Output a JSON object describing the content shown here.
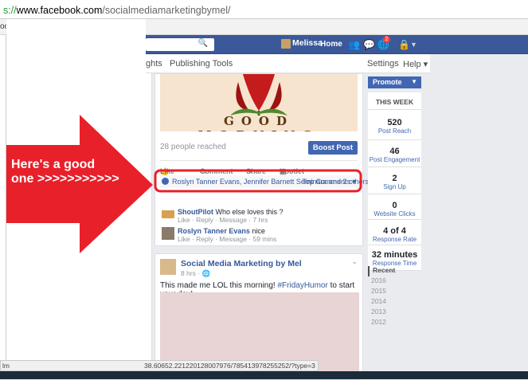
{
  "browser": {
    "url_scheme": "s://",
    "url_host": "www.facebook.com",
    "url_path": "/socialmediamarketingbymel/",
    "bookmark_stub": "oo",
    "status_url": "38.60652.221220128007976/785413978255252/?type=3",
    "status_stub": "lm"
  },
  "fb_header": {
    "user_name": "Melissa",
    "home_label": "Home",
    "notification_count": "2"
  },
  "subnav": {
    "insights_fragment": "ghts",
    "publishing_tools": "Publishing Tools",
    "settings": "Settings",
    "help": "Help ▾"
  },
  "post1": {
    "image_text": "GOOD MORNING",
    "reach": "28 people reached",
    "boost_label": "Boost Post",
    "actions": {
      "like": "Like",
      "comment": "Comment",
      "share": "Share",
      "hootlet": "Hootlet"
    },
    "likers": "Roslyn Tanner Evans, Jennifer Barnett Seminara and 2 others",
    "top_comments": "Top Comments ▾",
    "comments": [
      {
        "name": "ShoutPilot",
        "text": "Who else loves this ?",
        "meta": "Like · Reply · Message · 7 hrs"
      },
      {
        "name": "Roslyn Tanner Evans",
        "text": "nice",
        "meta": "Like · Reply · Message · 59 mins"
      }
    ]
  },
  "post2": {
    "page_name": "Social Media Marketing by Mel",
    "time": "8 hrs · ",
    "text": "This made me LOL this morning! ",
    "hashtag": "#FridayHumor",
    "text_end": " to start your day!"
  },
  "sidebar": {
    "promote_label": "Promote",
    "week_header": "THIS WEEK",
    "stats": [
      {
        "num": "520",
        "label": "Post Reach"
      },
      {
        "num": "46",
        "label": "Post Engagement"
      },
      {
        "num": "2",
        "label": "Sign Up"
      },
      {
        "num": "0",
        "label": "Website Clicks"
      },
      {
        "num": "4 of 4",
        "label": "Response Rate"
      },
      {
        "num": "32 minutes",
        "label": "Response Time"
      }
    ],
    "timeline": [
      "Recent",
      "2016",
      "2015",
      "2014",
      "2013",
      "2012"
    ]
  },
  "annotation": {
    "arrow_line1": "Here's a good",
    "arrow_line2": "one >>>>>>>>>>>",
    "arrow_color": "#e8202a",
    "highlight_color": "#e8202a"
  }
}
